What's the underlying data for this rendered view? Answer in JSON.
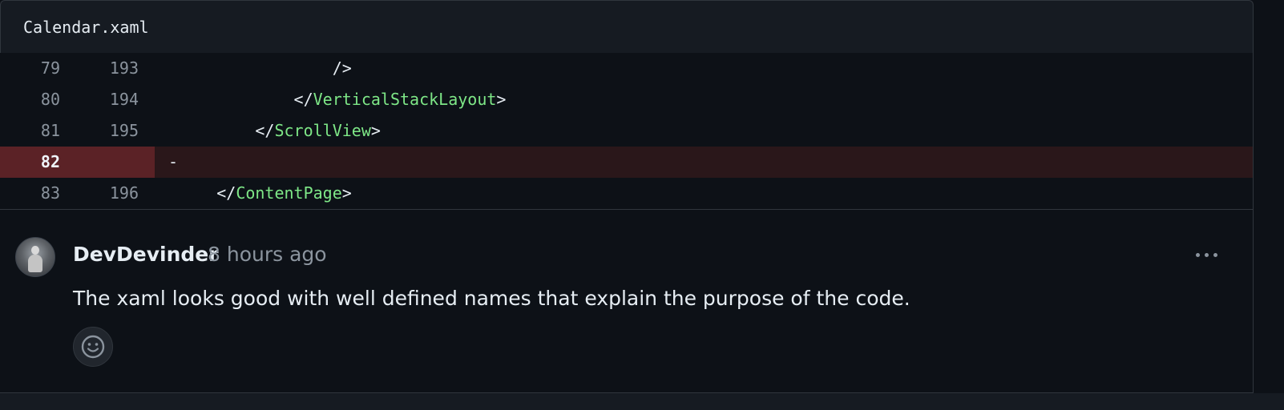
{
  "file": {
    "name": "Calendar.xaml"
  },
  "diff": {
    "rows": [
      {
        "old": "79",
        "new": "193",
        "indent": "                 ",
        "pre": "/>",
        "tag": "",
        "post": "",
        "type": "context"
      },
      {
        "old": "80",
        "new": "194",
        "indent": "             ",
        "pre": "</",
        "tag": "VerticalStackLayout",
        "post": ">",
        "type": "context"
      },
      {
        "old": "81",
        "new": "195",
        "indent": "         ",
        "pre": "</",
        "tag": "ScrollView",
        "post": ">",
        "type": "context"
      },
      {
        "old": "82",
        "new": "",
        "indent": "",
        "pre": "-",
        "tag": "",
        "post": "",
        "type": "deleted"
      },
      {
        "old": "83",
        "new": "196",
        "indent": "     ",
        "pre": "</",
        "tag": "ContentPage",
        "post": ">",
        "type": "context"
      }
    ]
  },
  "comment": {
    "author": "DevDevinder",
    "timestamp": "8 hours ago",
    "body": "The xaml looks good with well defined names that explain the purpose of the code.",
    "avatar_icon": "user-avatar",
    "more_icon": "kebab-horizontal-icon",
    "reaction_icon": "smiley-icon"
  },
  "colors": {
    "background": "#0d1117",
    "header": "#161b22",
    "border": "#30363d",
    "tag": "#7ee787",
    "deleted_row": "#2a171a",
    "deleted_gutter": "#5b2226",
    "muted": "#8b949e",
    "text": "#e6edf3"
  }
}
